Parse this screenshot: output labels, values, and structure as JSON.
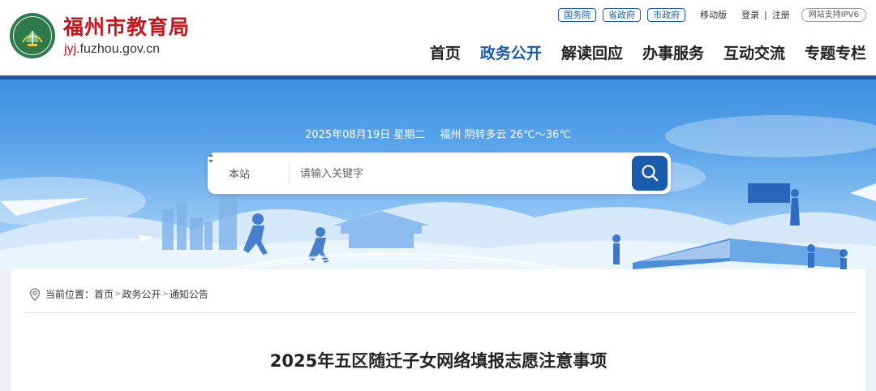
{
  "header": {
    "site_name": "福州市教育局",
    "domain_accent": "jyj",
    "domain_rest": ".fuzhou.gov.cn",
    "logo_ring_text": "FUZHOU EDUCATION",
    "top_links": {
      "gov_links": [
        "国务院",
        "省政府",
        "市政府"
      ],
      "mobile": "移动版",
      "login": "登录",
      "separator": "|",
      "register": "注册",
      "ipv6": "网站支持IPV6"
    },
    "nav": [
      "首页",
      "政务公开",
      "解读回应",
      "办事服务",
      "互动交流",
      "专题专栏"
    ],
    "active_nav": "政务公开"
  },
  "banner": {
    "date": "2025年08月19日 星期二",
    "weather": "福州 阴转多云 26℃～36℃"
  },
  "search": {
    "scope": "本站",
    "placeholder": "请输入关键字"
  },
  "breadcrumb": {
    "prefix": "当前位置：",
    "items": [
      "首页",
      "政务公开",
      "通知公告"
    ],
    "separator": ">"
  },
  "article": {
    "title": "2025年五区随迁子女网络填报志愿注意事项"
  },
  "colors": {
    "brand_red": "#c8161d",
    "brand_blue": "#1a5cab",
    "logo_green": "#2f7a4a"
  },
  "icons": [
    "logo-emblem",
    "search-icon",
    "chevron-updown-icon",
    "location-pin-icon"
  ]
}
